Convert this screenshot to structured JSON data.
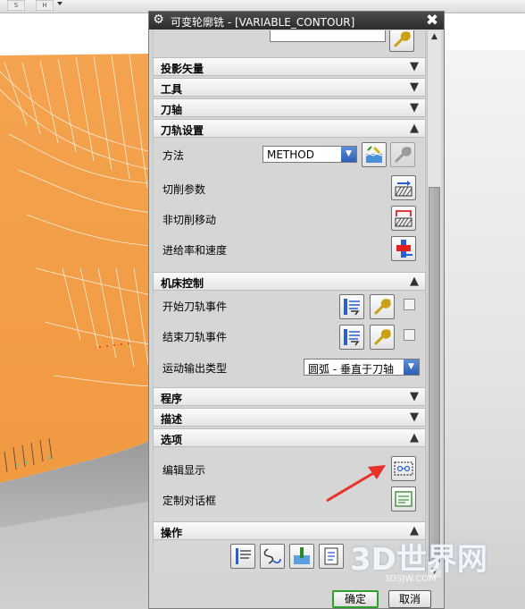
{
  "window": {
    "title": "可变轮廓铣 - [VARIABLE_CONTOUR]",
    "close_symbol": "✖",
    "gear_icon": "gear-icon"
  },
  "top_toolbar": {
    "btn1": "S",
    "btn2": "H"
  },
  "top_field": {
    "value": ""
  },
  "sections": {
    "projection_vector": {
      "title": "投影矢量",
      "state": "collapsed"
    },
    "tool": {
      "title": "工具",
      "state": "collapsed"
    },
    "tool_axis": {
      "title": "刀轴",
      "state": "collapsed"
    },
    "tool_path_settings": {
      "title": "刀轨设置",
      "state": "expanded",
      "method_label": "方法",
      "method_value": "METHOD",
      "cut_params_label": "切削参数",
      "non_cut_moves_label": "非切削移动",
      "feeds_speeds_label": "进给率和速度"
    },
    "machine_control": {
      "title": "机床控制",
      "state": "expanded",
      "start_events_label": "开始刀轨事件",
      "end_events_label": "结束刀轨事件",
      "motion_output_label": "运动输出类型",
      "motion_output_value": "圆弧 - 垂直于刀轴"
    },
    "program": {
      "title": "程序",
      "state": "collapsed"
    },
    "description": {
      "title": "描述",
      "state": "collapsed"
    },
    "options": {
      "title": "选项",
      "state": "expanded",
      "edit_display_label": "编辑显示",
      "custom_dialog_label": "定制对话框"
    },
    "actions": {
      "title": "操作",
      "state": "expanded"
    }
  },
  "buttons": {
    "ok": "确定",
    "cancel": "取消"
  },
  "watermark": {
    "main": "3D世界网",
    "sub": "3DSJW.COM"
  },
  "colors": {
    "part_orange": "#f4a04a",
    "title_bar": "#2b2b2b",
    "ok_border": "#2e9f2e",
    "arrow_red": "#e8312a"
  }
}
